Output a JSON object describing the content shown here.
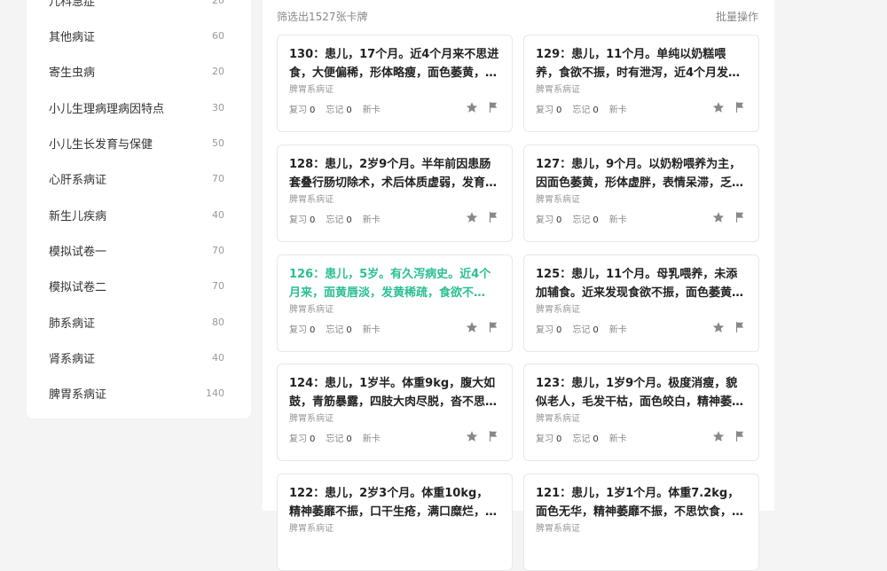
{
  "sidebar": {
    "items": [
      {
        "name": "儿科急症",
        "count": "20"
      },
      {
        "name": "其他病证",
        "count": "60"
      },
      {
        "name": "寄生虫病",
        "count": "20"
      },
      {
        "name": "小儿生理病理病因特点",
        "count": "30"
      },
      {
        "name": "小儿生长发育与保健",
        "count": "50"
      },
      {
        "name": "心肝系病证",
        "count": "70"
      },
      {
        "name": "新生儿疾病",
        "count": "40"
      },
      {
        "name": "模拟试卷一",
        "count": "70"
      },
      {
        "name": "模拟试卷二",
        "count": "70"
      },
      {
        "name": "肺系病证",
        "count": "80"
      },
      {
        "name": "肾系病证",
        "count": "40"
      },
      {
        "name": "脾胃系病证",
        "count": "140"
      }
    ]
  },
  "header": {
    "filter_count": "筛选出1527张卡牌",
    "batch_label": "批量操作"
  },
  "labels": {
    "review": "复习",
    "forget": "忘记",
    "new_card": "新卡"
  },
  "cards": [
    {
      "title": "130：患儿，17个月。近4个月来不思进食，大便偏稀，形体略瘦，面色萎黄，…",
      "category": "脾胃系病证",
      "review": "0",
      "forget": "0"
    },
    {
      "title": "129：患儿，11个月。单纯以奶糕喂养，食欲不振，时有泄泻，近4个月发现面色苍…",
      "category": "脾胃系病证",
      "review": "0",
      "forget": "0"
    },
    {
      "title": "128：患儿，2岁9个月。半年前因患肠套叠行肠切除术，术后体质虚弱，发育迟缓…",
      "category": "脾胃系病证",
      "review": "0",
      "forget": "0"
    },
    {
      "title": "127：患儿，9个月。以奶粉喂养为主，因面色萎黄，形体虚胖，表情呆滞，乏力…",
      "category": "脾胃系病证",
      "review": "0",
      "forget": "0"
    },
    {
      "title": "126：患儿，5岁。有久泻病史。近4个月来，面黄唇淡，发黄稀疏，食欲不振，…",
      "category": "脾胃系病证",
      "review": "0",
      "forget": "0"
    },
    {
      "title": "125：患儿，11个月。母乳喂养，未添加辅食。近来发现食欲不振，面色萎黄，唇…",
      "category": "脾胃系病证",
      "review": "0",
      "forget": "0"
    },
    {
      "title": "124：患儿，1岁半。体重9kg，腹大如鼓，青筋暴露，四肢大肉尽脱，沓不思…",
      "category": "脾胃系病证",
      "review": "0",
      "forget": "0"
    },
    {
      "title": "123：患儿，1岁9个月。极度消瘦，貌似老人，毛发干枯，面色皎白，精神萎靡，…",
      "category": "脾胃系病证",
      "review": "0",
      "forget": "0"
    },
    {
      "title": "122：患儿，2岁3个月。体重10kg，精神萎靡不振，口干生疮，满口糜烂，面赤…",
      "category": "脾胃系病证",
      "review": "0",
      "forget": "0"
    },
    {
      "title": "121：患儿，1岁1个月。体重7.2kg，面色无华，精神萎靡不振，不思饮食，腹大…",
      "category": "脾胃系病证",
      "review": "0",
      "forget": "0"
    }
  ]
}
